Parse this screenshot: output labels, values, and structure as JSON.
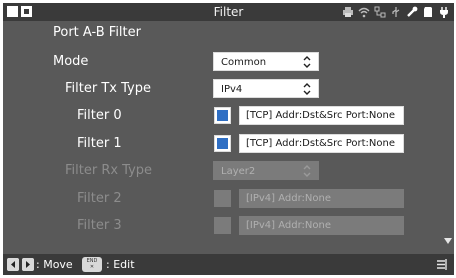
{
  "titlebar": {
    "title": "Filter",
    "status_icons": [
      "printer-icon",
      "wifi-icon",
      "network-icon",
      "usb-icon",
      "tools-icon",
      "sd-card-icon",
      "power-plug-icon"
    ]
  },
  "section": {
    "title": "Port A-B Filter"
  },
  "mode": {
    "label": "Mode",
    "value": "Common"
  },
  "tx": {
    "label": "Filter Tx Type",
    "value": "IPv4",
    "filters": [
      {
        "label": "Filter 0",
        "checked": true,
        "value": "[TCP] Addr:Dst&Src Port:None"
      },
      {
        "label": "Filter 1",
        "checked": true,
        "value": "[TCP] Addr:Dst&Src Port:None"
      }
    ]
  },
  "rx": {
    "label": "Filter Rx Type",
    "value": "Layer2",
    "filters": [
      {
        "label": "Filter 2",
        "checked": false,
        "value": "[IPv4] Addr:None"
      },
      {
        "label": "Filter 3",
        "checked": false,
        "value": "[IPv4] Addr:None"
      }
    ]
  },
  "footer": {
    "move_hint": ": Move",
    "end_key_top": "END",
    "end_key_bottom": "✕",
    "edit_hint": ": Edit"
  },
  "colors": {
    "background": "#595959",
    "bar": "#3a3a3a",
    "checkbox_mark": "#2f6fc4",
    "dim_text": "#8c8c8c"
  }
}
